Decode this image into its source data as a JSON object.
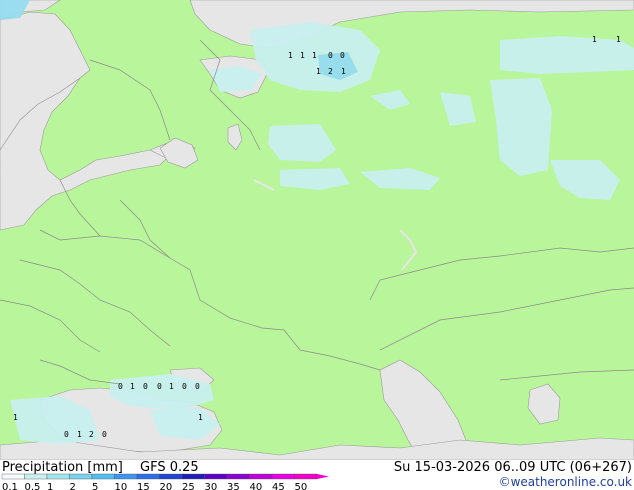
{
  "title": "Precipitation [mm]",
  "model": "GFS 0.25",
  "valid_time": "Su 15-03-2026 06..09 UTC (06+267)",
  "credit": "©weatheronline.co.uk",
  "colors": {
    "land": "#b9f59a",
    "sea": "#e6e6e6",
    "border": "#8c8c8c",
    "precip_light": "#c8f0f0",
    "precip_mid": "#96dcf0"
  },
  "legend": {
    "ticks": [
      "0.1",
      "0.5",
      "1",
      "2",
      "5",
      "10",
      "15",
      "20",
      "25",
      "30",
      "35",
      "40",
      "45",
      "50"
    ],
    "colors": [
      "#f5fafa",
      "#c8f0f0",
      "#a0e6f0",
      "#78d2f0",
      "#50bef0",
      "#3c96f0",
      "#2d6ee6",
      "#1e46d2",
      "#1e1eb4",
      "#5a00c8",
      "#8c00d2",
      "#be00dc",
      "#e600e6",
      "#f000c8"
    ]
  },
  "grid_values": [
    {
      "t": "1"
    },
    {
      "t": "1"
    },
    {
      "t": "1"
    },
    {
      "t": "0"
    },
    {
      "t": "0"
    },
    {
      "t": "1"
    },
    {
      "t": "2"
    },
    {
      "t": "1"
    },
    {
      "t": "1"
    },
    {
      "t": "1"
    },
    {
      "t": "0"
    },
    {
      "t": "1"
    },
    {
      "t": "2"
    },
    {
      "t": "0"
    },
    {
      "t": "1"
    },
    {
      "t": "1"
    },
    {
      "t": "1"
    },
    {
      "t": "0"
    },
    {
      "t": "0"
    },
    {
      "t": "0"
    },
    {
      "t": "1"
    },
    {
      "t": "0"
    },
    {
      "t": "0"
    }
  ]
}
